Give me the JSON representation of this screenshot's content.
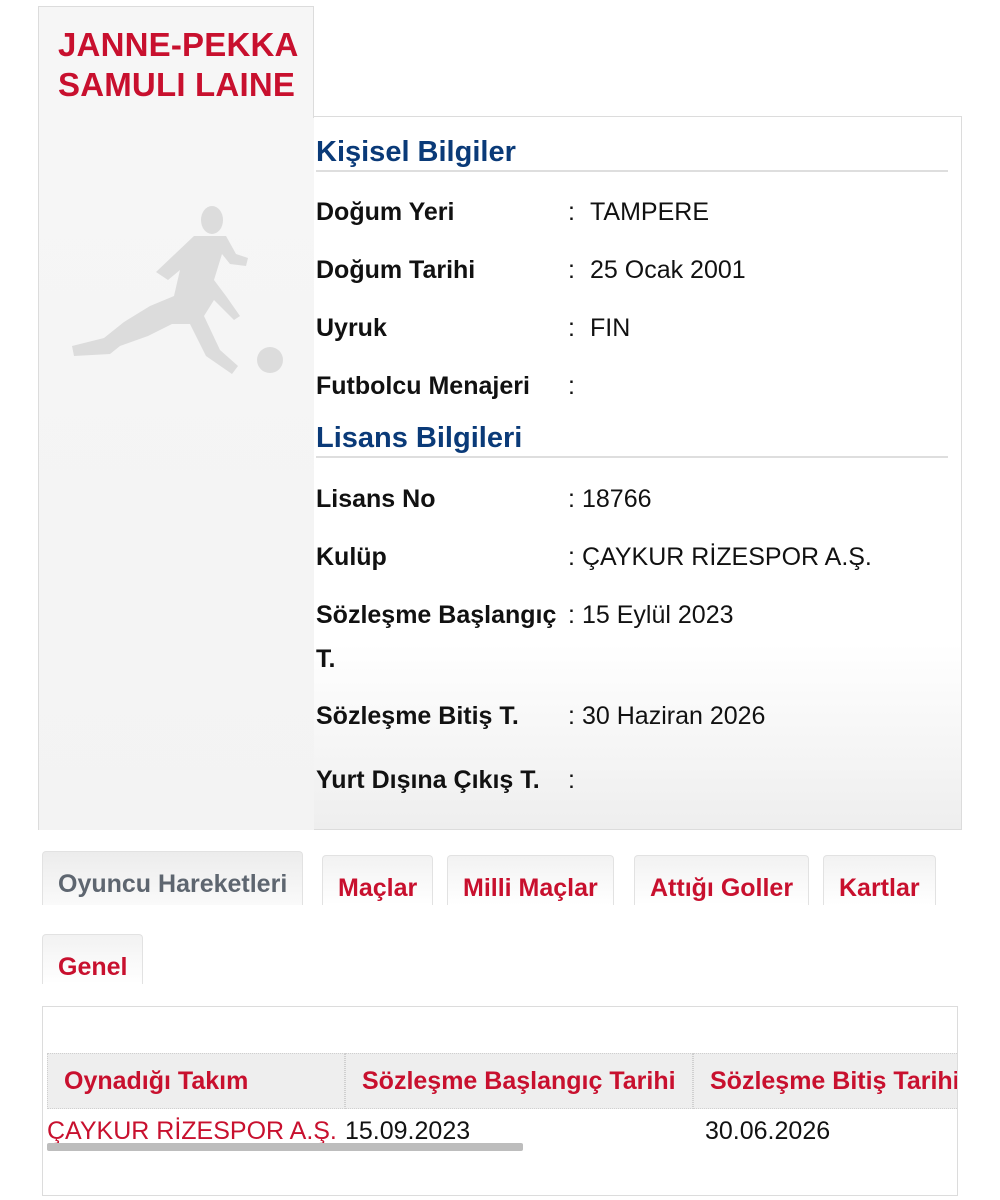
{
  "player": {
    "name_line1": "JANNE-PEKKA",
    "name_line2": "SAMULI LAINE",
    "avatar_icon": "footballer-silhouette-icon"
  },
  "personal": {
    "title": "Kişisel Bilgiler",
    "rows": [
      {
        "label": "Doğum Yeri",
        "value": "TAMPERE"
      },
      {
        "label": "Doğum Tarihi",
        "value": "25 Ocak 2001"
      },
      {
        "label": "Uyruk",
        "value": "FIN"
      },
      {
        "label": "Futbolcu Menajeri",
        "value": ""
      }
    ]
  },
  "license": {
    "title": "Lisans Bilgileri",
    "rows": [
      {
        "label": "Lisans No",
        "value": "18766"
      },
      {
        "label": "Kulüp",
        "value": "ÇAYKUR RİZESPOR A.Ş."
      },
      {
        "label_line1": "Sözleşme Başlangıç",
        "label_line2": "T.",
        "value": "15 Eylül 2023"
      },
      {
        "label": "Sözleşme Bitiş T.",
        "value": "30 Haziran 2026"
      },
      {
        "label": "Yurt Dışına Çıkış T.",
        "value": ""
      }
    ]
  },
  "tabs": [
    {
      "label": "Oyuncu Hareketleri",
      "active": true
    },
    {
      "label": "Maçlar"
    },
    {
      "label": "Milli Maçlar"
    },
    {
      "label": "Attığı Goller"
    },
    {
      "label": "Kartlar"
    },
    {
      "label": "Genel"
    }
  ],
  "table": {
    "headers": [
      "Oynadığı Takım",
      "Sözleşme Başlangıç Tarihi",
      "Sözleşme Bitiş Tarihi"
    ],
    "rows": [
      {
        "team": "ÇAYKUR RİZESPOR A.Ş.",
        "start": "15.09.2023",
        "end": "30.06.2026"
      }
    ]
  },
  "colors": {
    "accent_red": "#c8102e",
    "section_blue": "#0a3a78",
    "inactive_tab_text": "#5e6670"
  }
}
